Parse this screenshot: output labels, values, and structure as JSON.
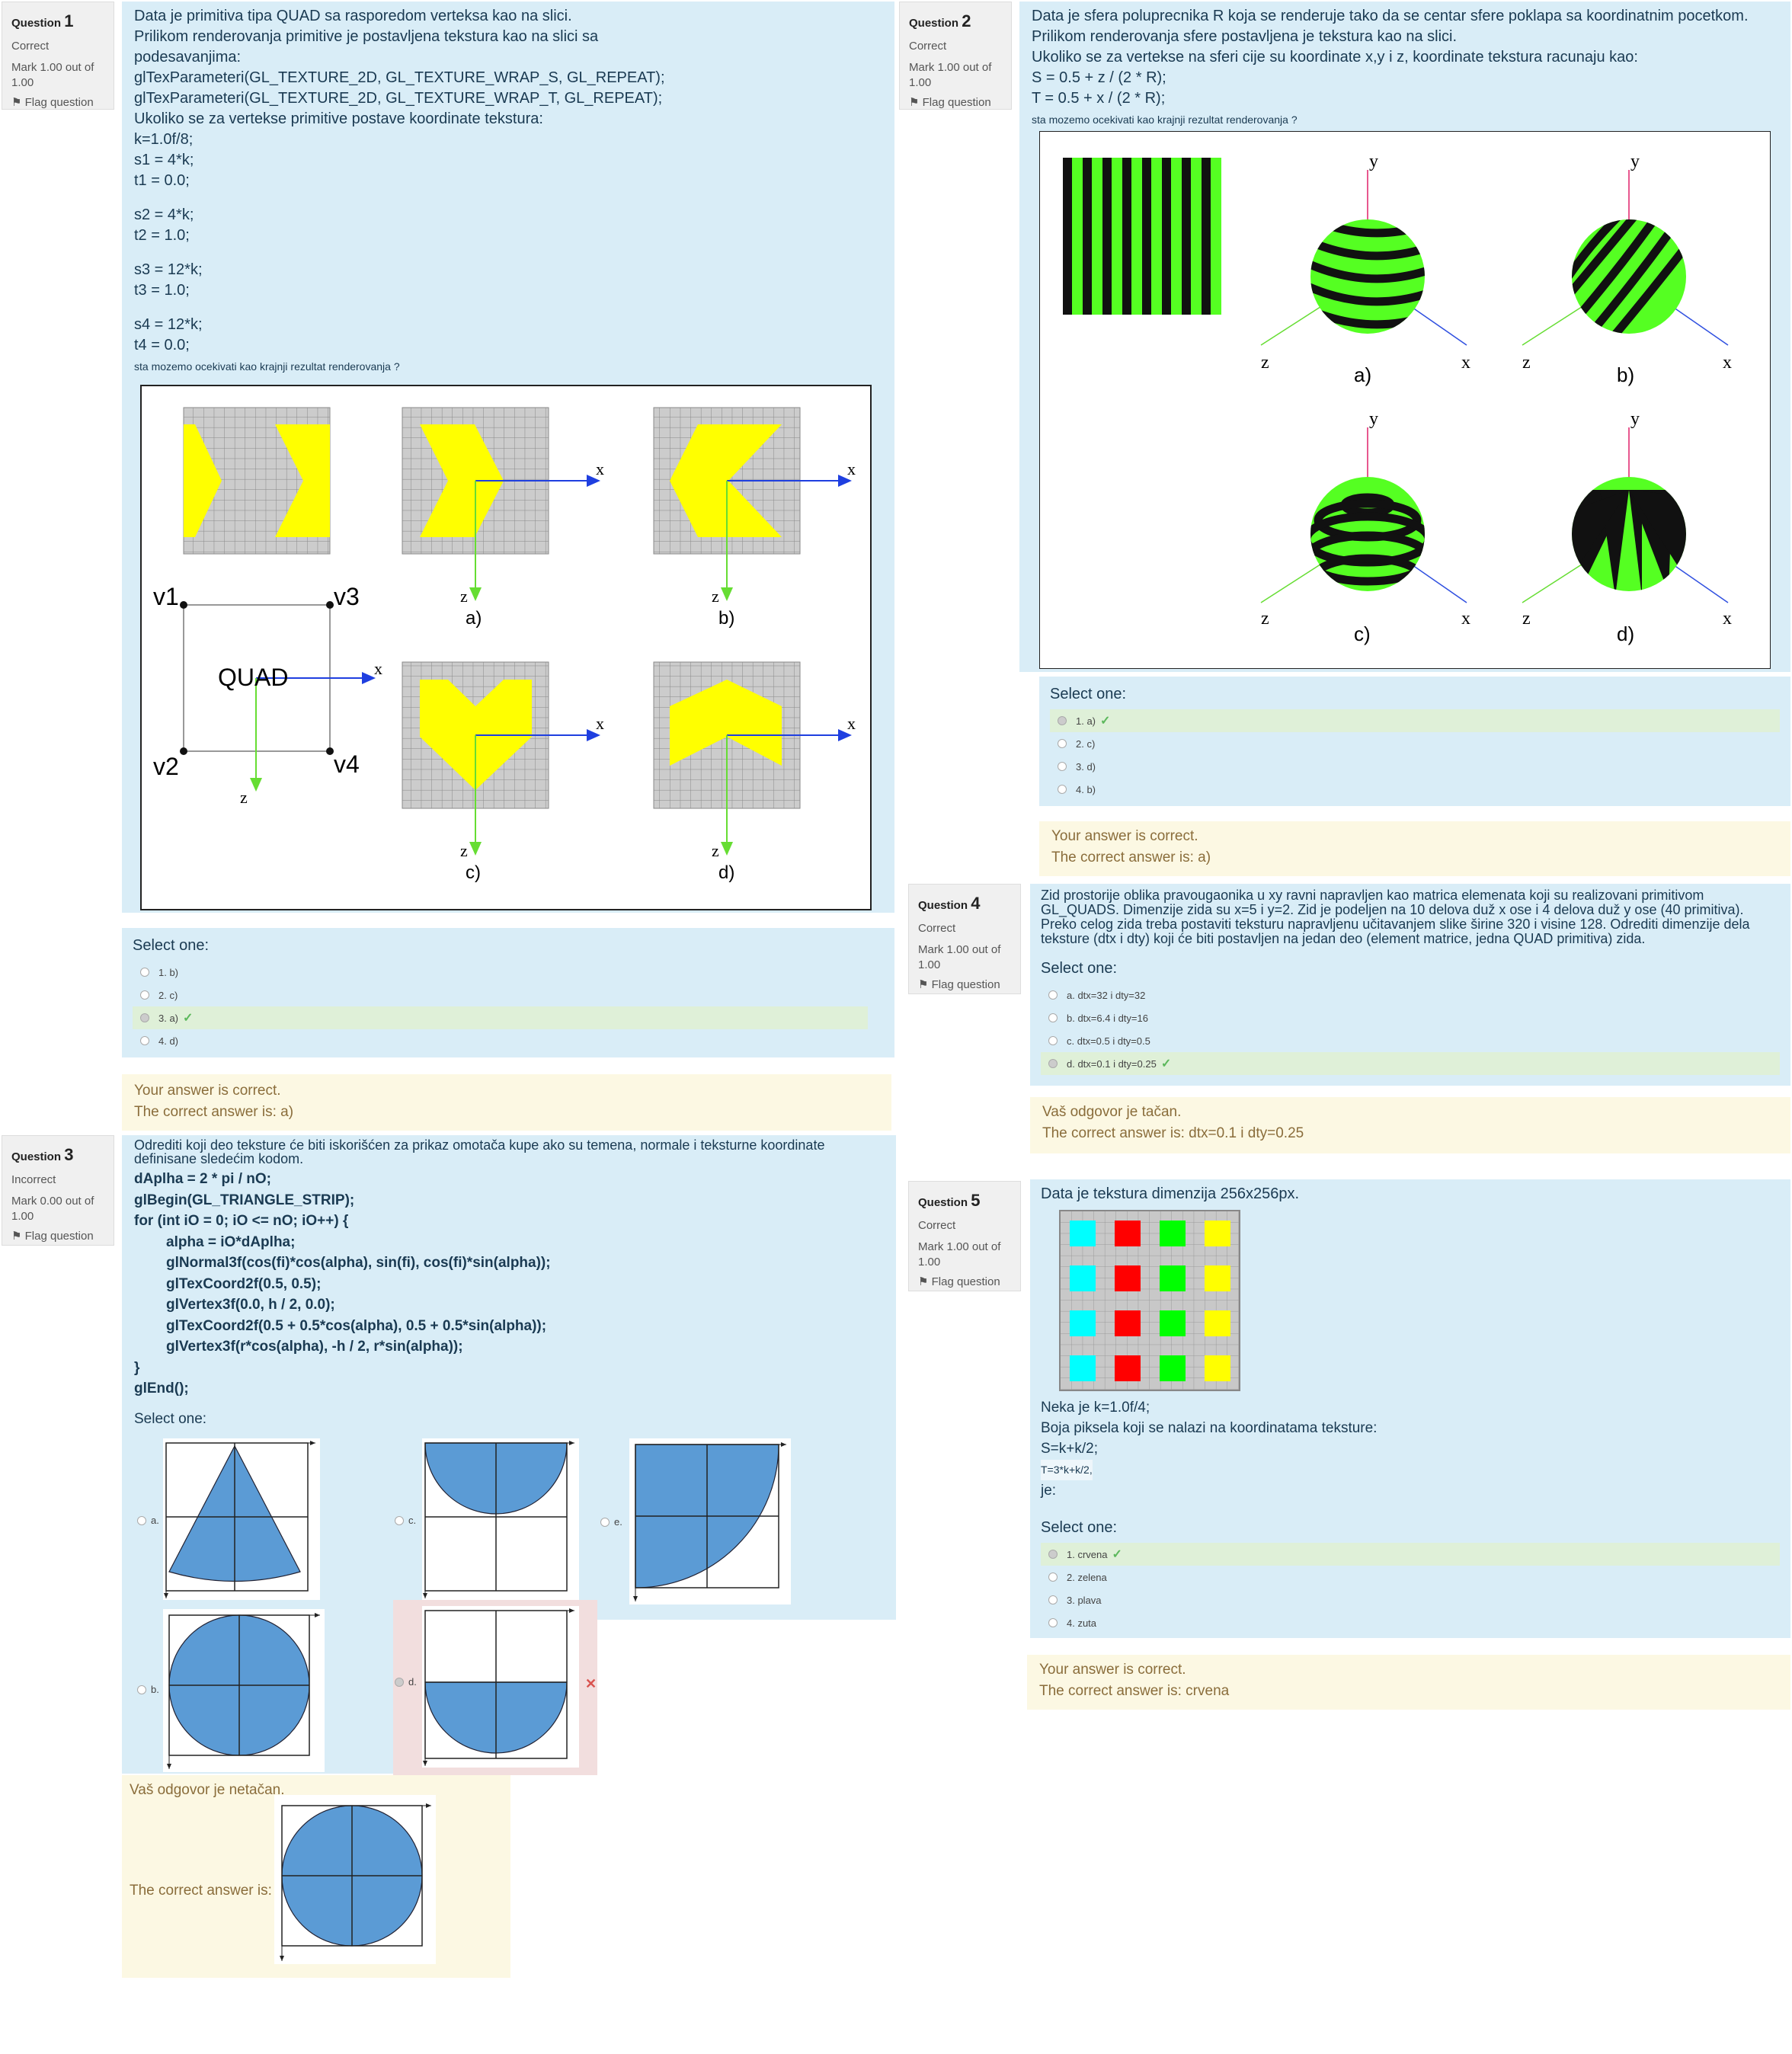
{
  "q1": {
    "number_label": "Question",
    "number": "1",
    "status": "Correct",
    "mark": "Mark 1.00 out of 1.00",
    "flag": "Flag question",
    "text": [
      "Data je primitiva tipa QUAD sa rasporedom verteksa kao na slici.",
      "Prilikom renderovanja primitive je postavljena tekstura kao na slici sa",
      "podesavanjima:",
      "glTexParameteri(GL_TEXTURE_2D, GL_TEXTURE_WRAP_S, GL_REPEAT);",
      "glTexParameteri(GL_TEXTURE_2D, GL_TEXTURE_WRAP_T, GL_REPEAT);",
      "Ukoliko se za vertekse primitive postave koordinate tekstura:",
      "k=1.0f/8;",
      "s1 = 4*k;",
      "t1 = 0.0;",
      "s2 = 4*k;",
      "t2 = 1.0;",
      "s3 = 12*k;",
      "t3 = 1.0;",
      "s4 = 12*k;",
      "t4 = 0.0;"
    ],
    "question": "sta mozemo ocekivati kao krajnji rezultat renderovanja ?",
    "fig_labels": {
      "v1": "v1",
      "v2": "v2",
      "v3": "v3",
      "v4": "v4",
      "quad": "QUAD",
      "x": "x",
      "z": "z",
      "a": "a)",
      "b": "b)",
      "c": "c)",
      "d": "d)"
    },
    "select_one": "Select one:",
    "options": [
      "1. b)",
      "2. c)",
      "3. a)",
      "4. d)"
    ],
    "selected_index": 2,
    "feedback": "Your answer is correct.",
    "correct_answer": "The correct answer is: a)"
  },
  "q2": {
    "number_label": "Question",
    "number": "2",
    "status": "Correct",
    "mark": "Mark 1.00 out of 1.00",
    "flag": "Flag question",
    "text": [
      "Data je sfera poluprecnika R koja se renderuje tako da se centar sfere poklapa sa koordinatnim pocetkom.",
      "Prilikom renderovanja sfere postavljena je tekstura kao na slici.",
      "Ukoliko se za vertekse na sferi cije su koordinate x,y i z, koordinate tekstura racunaju kao:",
      "S = 0.5 + z / (2 * R);",
      "T = 0.5 + x / (2 * R);"
    ],
    "question": "sta mozemo ocekivati kao krajnji rezultat renderovanja ?",
    "fig_labels": {
      "x": "x",
      "y": "y",
      "z": "z",
      "a": "a)",
      "b": "b)",
      "c": "c)",
      "d": "d)"
    },
    "select_one": "Select one:",
    "options": [
      "1. a)",
      "2. c)",
      "3. d)",
      "4. b)"
    ],
    "selected_index": 0,
    "feedback": "Your answer is correct.",
    "correct_answer": "The correct answer is: a)"
  },
  "q3": {
    "number_label": "Question",
    "number": "3",
    "status": "Incorrect",
    "mark": "Mark 0.00 out of 1.00",
    "flag": "Flag question",
    "text": [
      "Odrediti koji deo teksture će biti iskorišćen za prikaz omotača kupe ako su temena, normale i teksturne koordinate",
      "definisane sledećim kodom."
    ],
    "code": [
      "dAplha = 2 * pi / nO;",
      "glBegin(GL_TRIANGLE_STRIP);",
      "for (int iO = 0; iO <= nO; iO++) {",
      "alpha = iO*dAplha;",
      "glNormal3f(cos(fi)*cos(alpha), sin(fi), cos(fi)*sin(alpha));",
      "glTexCoord2f(0.5, 0.5);",
      "glVertex3f(0.0, h / 2, 0.0);",
      "glTexCoord2f(0.5 + 0.5*cos(alpha), 0.5 + 0.5*sin(alpha));",
      "glVertex3f(r*cos(alpha), -h / 2, r*sin(alpha));",
      "}",
      "glEnd();"
    ],
    "select_one": "Select one:",
    "option_letters": [
      "a.",
      "c.",
      "e.",
      "b.",
      "d."
    ],
    "feedback": "Vaš odgovor je netačan.",
    "correct_answer_label": "The correct answer is:",
    "wrong_mark": "✕"
  },
  "q4": {
    "number_label": "Question",
    "number": "4",
    "status": "Correct",
    "mark": "Mark 1.00 out of 1.00",
    "flag": "Flag question",
    "text": "Zid prostorije oblika pravougaonika u xy ravni napravljen kao matrica elemenata koji su realizovani primitivom GL_QUADS. Dimenzije zida su x=5 i y=2. Zid je podeljen na 10 delova duž x ose i 4 delova duž y ose (40 primitiva). Preko celog zida treba postaviti teksturu napravljenu učitavanjem slike širine 320 i visine 128. Odrediti dimenzije dela teksture (dtx i dty) koji će biti postavljen na jedan deo (element matrice, jedna QUAD primitiva) zida.",
    "select_one": "Select one:",
    "options": [
      "a. dtx=32 i dty=32",
      "b. dtx=6.4 i dty=16",
      "c. dtx=0.5 i dty=0.5",
      "d. dtx=0.1 i dty=0.25"
    ],
    "selected_index": 3,
    "feedback": "Vaš odgovor je tačan.",
    "correct_answer": "The correct answer is: dtx=0.1 i dty=0.25"
  },
  "q5": {
    "number_label": "Question",
    "number": "5",
    "status": "Correct",
    "mark": "Mark 1.00 out of 1.00",
    "flag": "Flag question",
    "text_top": "Data je tekstura dimenzija 256x256px.",
    "grid_colors": [
      "#00ffff",
      "#ff0000",
      "#00ff00",
      "#ffff00"
    ],
    "text_lines": [
      "Neka je k=1.0f/4;",
      "Boja piksela koji se nalazi na koordinatama teksture:",
      "S=k+k/2;"
    ],
    "formula_small": "T=3*k+k/2,",
    "text_end": "je:",
    "select_one": "Select one:",
    "options": [
      "1. crvena",
      "2. zelena",
      "3. plava",
      "4. zuta"
    ],
    "selected_index": 0,
    "feedback": "Your answer is correct.",
    "correct_answer": "The correct answer is: crvena"
  },
  "colors": {
    "panel_blue": "#d9edf7",
    "feedback_yellow": "#fcf8e3",
    "correct_green": "#dff0d8",
    "wrong_red": "#f2dede",
    "shape_yellow": "#ffff00",
    "stripe_green": "#55ff22",
    "disk_blue": "#5b9bd5"
  }
}
